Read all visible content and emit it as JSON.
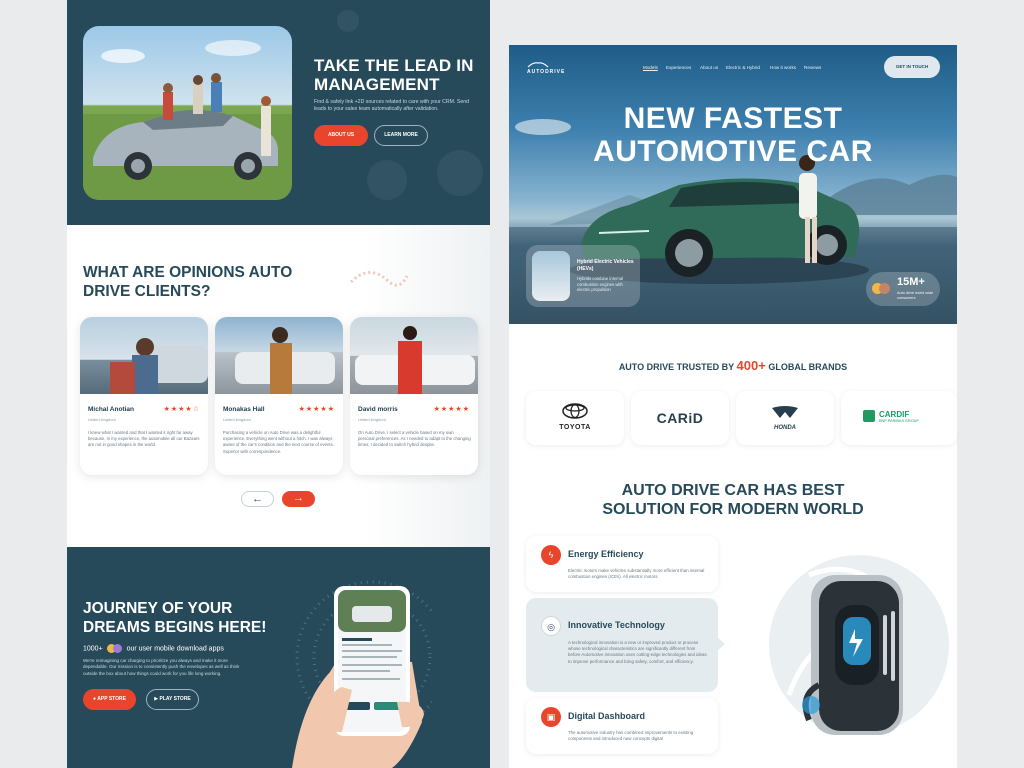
{
  "left": {
    "hero": {
      "title": "TAKE THE LEAD IN MANAGEMENT",
      "desc": "Find & safely link +2D sources related to care with your CRM. Send leads to your sales team automatically after validation.",
      "about_btn": "ABOUT US",
      "learn_btn": "LEARN MORE"
    },
    "opinions": {
      "title": "WHAT ARE OPINIONS AUTO DRIVE CLIENTS?",
      "cards": [
        {
          "name": "Michal Anotian",
          "location": "United kingdom",
          "stars": "★★★★☆",
          "text": "I knew what I wanted and that I wanted it right far away because, in my experience, the automobile all our Bazaars are not in good shapes in the world."
        },
        {
          "name": "Monakas Hall",
          "location": "United kingdom",
          "stars": "★★★★★",
          "text": "Purchasing a vehicle on Auto Drive was a delightful experience. Everything went without a hitch. I was always aware of the car's condition and the next course of events. Superior with correspondence."
        },
        {
          "name": "David morris",
          "location": "United kingdom",
          "stars": "★★★★★",
          "text": "On Auto Drive, I select a vehicle based on my own personal preferences. As I needed to adapt to the changing times, I decided to switch hybrid despite."
        }
      ],
      "prev_icon": "←",
      "next_icon": "→"
    },
    "journey": {
      "title": "JOURNEY OF YOUR DREAMS BEGINS HERE!",
      "count": "1000+",
      "count_label": "our user mobile download apps",
      "desc": "We're reimagining car charging to prioritize you always and make it more dependable. Our mission is to consistently push the envelopes as well as think outside the box about how things could work for you life long working.",
      "app_store": "APP STORE",
      "play_store": "PLAY STORE"
    }
  },
  "right": {
    "nav": {
      "logo": "AUTODRIVE",
      "links": [
        "Models",
        "Experiences",
        "About us",
        "Electric & Hybrid",
        "How it works",
        "Reviews"
      ],
      "cta": "GET IN TOUCH"
    },
    "hero": {
      "title_line1": "NEW FASTEST",
      "title_line2": "AUTOMOTIVE CAR",
      "card_title": "Hybrid Electric Vehicles (HEVs)",
      "card_desc": "Hybrids combine internal combustion engines with electric propulsion",
      "stat_value": "15M+",
      "stat_label": "Auto drive world wide consumers"
    },
    "brands": {
      "caption_pre": "AUTO DRIVE TRUSTED BY",
      "caption_num": "400+",
      "caption_post": "GLOBAL BRANDS",
      "items": [
        "TOYOTA",
        "CARiD",
        "HONDA",
        "CARDIF"
      ],
      "cardif_sub": "BNP PARIBAS GROUP"
    },
    "solution": {
      "title_line1": "AUTO DRIVE CAR HAS BEST",
      "title_line2": "SOLUTION FOR MODERN WORLD",
      "features": [
        {
          "title": "Energy Efficiency",
          "desc": "Electric motors make vehicles substantially more efficient than internal combustion engines (ICEs). All electric motors"
        },
        {
          "title": "Innovative Technology",
          "desc": "A technological innovation is a new or improved product or process whose technological characteristics are significantly different from before Automotive innovation uses cutting-edge technologies and ideas to improve performance and bring safety, comfort, and efficiency."
        },
        {
          "title": "Digital Dashboard",
          "desc": "The automotive industry has combined improvements to existing components and introduced new concepts digital"
        }
      ]
    }
  },
  "colors": {
    "navy": "#274a5b",
    "accent": "#e8452c",
    "bg": "#e9ebed"
  }
}
